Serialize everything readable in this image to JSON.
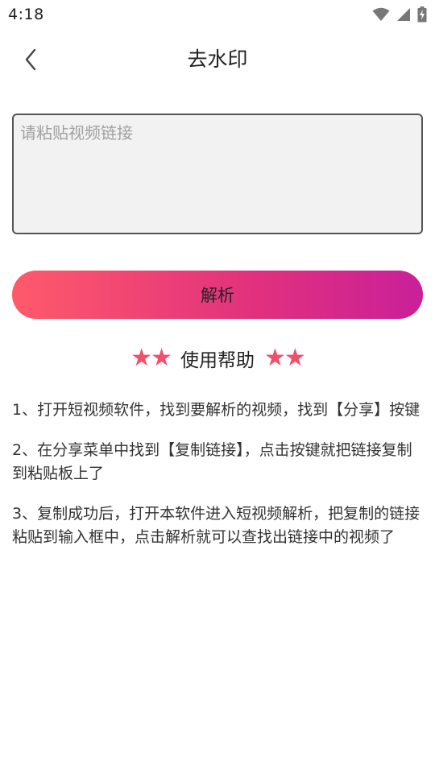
{
  "status_bar": {
    "time": "4:18",
    "icons": [
      "wifi-icon",
      "cell-signal-icon",
      "battery-charging-icon"
    ]
  },
  "header": {
    "title": "去水印",
    "back_icon": "chevron-left-icon"
  },
  "input": {
    "placeholder": "请粘贴视频链接",
    "value": ""
  },
  "parse_button": {
    "label": "解析",
    "gradient_colors": [
      "#ff5a6a",
      "#c9209a"
    ]
  },
  "help": {
    "stars_left": "★★",
    "title": "使用帮助",
    "stars_right": "★★",
    "star_color": "#f0506a",
    "items": [
      "1、打开短视频软件，找到要解析的视频，找到【分享】按键",
      "2、在分享菜单中找到【复制链接】，点击按键就把链接复制到粘贴板上了",
      "3、复制成功后，打开本软件进入短视频解析，把复制的链接粘贴到输入框中，点击解析就可以查找出链接中的视频了"
    ]
  }
}
